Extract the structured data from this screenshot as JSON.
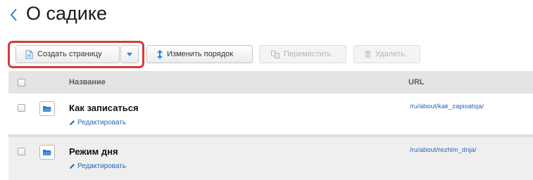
{
  "header": {
    "back_icon": "chevron-left-icon",
    "title": "О садике"
  },
  "toolbar": {
    "create_label": "Создать страницу",
    "create_icon": "new-page-icon",
    "dropdown_icon": "caret-down-icon",
    "order_label": "Изменить порядок",
    "order_icon": "sort-arrows-icon",
    "move_label": "Переместить",
    "move_icon": "move-icon",
    "delete_label": "Удалить",
    "delete_icon": "trash-icon",
    "highlight_color": "#d33b3b"
  },
  "table": {
    "columns": {
      "name": "Название",
      "url": "URL"
    },
    "rows": [
      {
        "name": "Как записаться",
        "edit": "Редактировать",
        "url": "/ru/about/kak_zapisatsja/",
        "icon": "folder-icon"
      },
      {
        "name": "Режим дня",
        "edit": "Редактировать",
        "url": "/ru/about/rezhim_dnja/",
        "icon": "folder-icon"
      }
    ]
  },
  "colors": {
    "link": "#2a65b3",
    "accent": "#1e88e5",
    "header_bg": "#e4e4e4"
  }
}
